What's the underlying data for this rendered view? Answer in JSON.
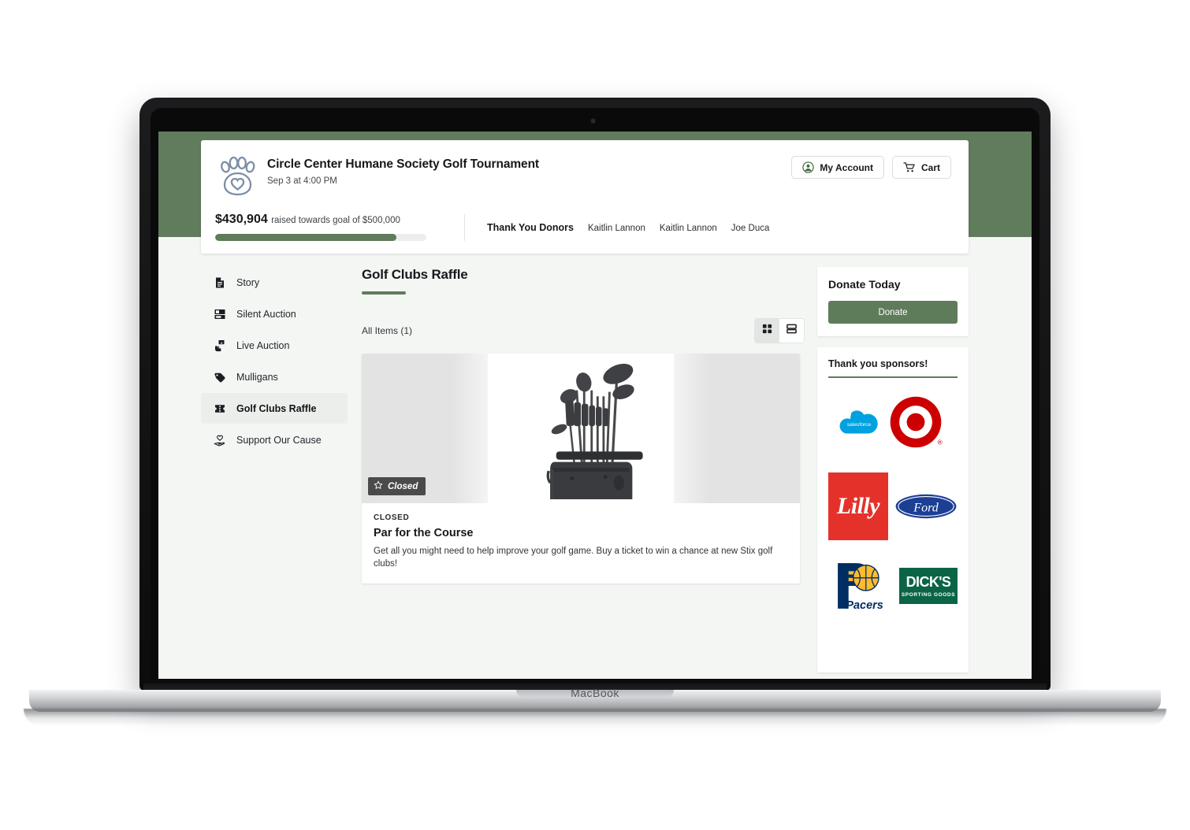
{
  "device": {
    "brand_label": "MacBook"
  },
  "header": {
    "logo_icon": "paw-heart-logo",
    "event_title": "Circle Center Humane Society Golf Tournament",
    "event_date": "Sep 3 at 4:00 PM",
    "account_button": "My Account",
    "account_icon": "user-circle-icon",
    "cart_button": "Cart",
    "cart_icon": "shopping-cart-icon",
    "raised_amount": "$430,904",
    "raised_suffix": "raised towards goal of $500,000",
    "progress_percent": 86,
    "donors_label": "Thank You Donors",
    "donors": [
      "Kaitlin Lannon",
      "Kaitlin Lannon",
      "Joe Duca"
    ],
    "band_color": "#607c5c",
    "accent_color": "#5f7c5a"
  },
  "sidebar": {
    "items": [
      {
        "label": "Story",
        "icon": "document-icon",
        "active": false
      },
      {
        "label": "Silent Auction",
        "icon": "auction-board-icon",
        "active": false
      },
      {
        "label": "Live Auction",
        "icon": "hand-paddle-icon",
        "active": false
      },
      {
        "label": "Mulligans",
        "icon": "tag-icon",
        "active": false
      },
      {
        "label": "Golf Clubs Raffle",
        "icon": "ticket-icon",
        "active": true
      },
      {
        "label": "Support Our Cause",
        "icon": "hand-heart-icon",
        "active": false
      }
    ]
  },
  "main": {
    "section_title": "Golf Clubs Raffle",
    "items_count_label": "All Items (1)",
    "view_modes": [
      {
        "name": "grid-view",
        "icon": "grid-icon",
        "selected": true
      },
      {
        "name": "list-view",
        "icon": "list-icon",
        "selected": false
      }
    ],
    "item": {
      "badge_text": "Closed",
      "badge_icon": "star-outline-icon",
      "status": "CLOSED",
      "name": "Par for the Course",
      "description": "Get all you might need to help improve your golf game. Buy a ticket to win a chance at new Stix golf clubs!",
      "image_alt": "golf-clubs-in-bag-photo"
    }
  },
  "rail": {
    "donate_heading": "Donate Today",
    "donate_button": "Donate",
    "sponsors_heading": "Thank you sponsors!",
    "sponsors": [
      {
        "name": "Salesforce",
        "icon": "salesforce-logo",
        "color": "#00a1e0"
      },
      {
        "name": "Target",
        "icon": "target-logo",
        "color": "#cc0000"
      },
      {
        "name": "Lilly",
        "icon": "lilly-logo",
        "color": "#e4322b",
        "wordmark": "Lilly"
      },
      {
        "name": "Ford",
        "icon": "ford-logo",
        "color": "#1c3f94",
        "wordmark": "Ford"
      },
      {
        "name": "Indiana Pacers",
        "icon": "pacers-logo",
        "color": "#002d62",
        "wordmark": "Pacers"
      },
      {
        "name": "Dick's Sporting Goods",
        "icon": "dicks-logo",
        "color": "#0b6446",
        "wordmark_top": "DICK'S",
        "wordmark_bottom": "SPORTING GOODS"
      }
    ]
  }
}
